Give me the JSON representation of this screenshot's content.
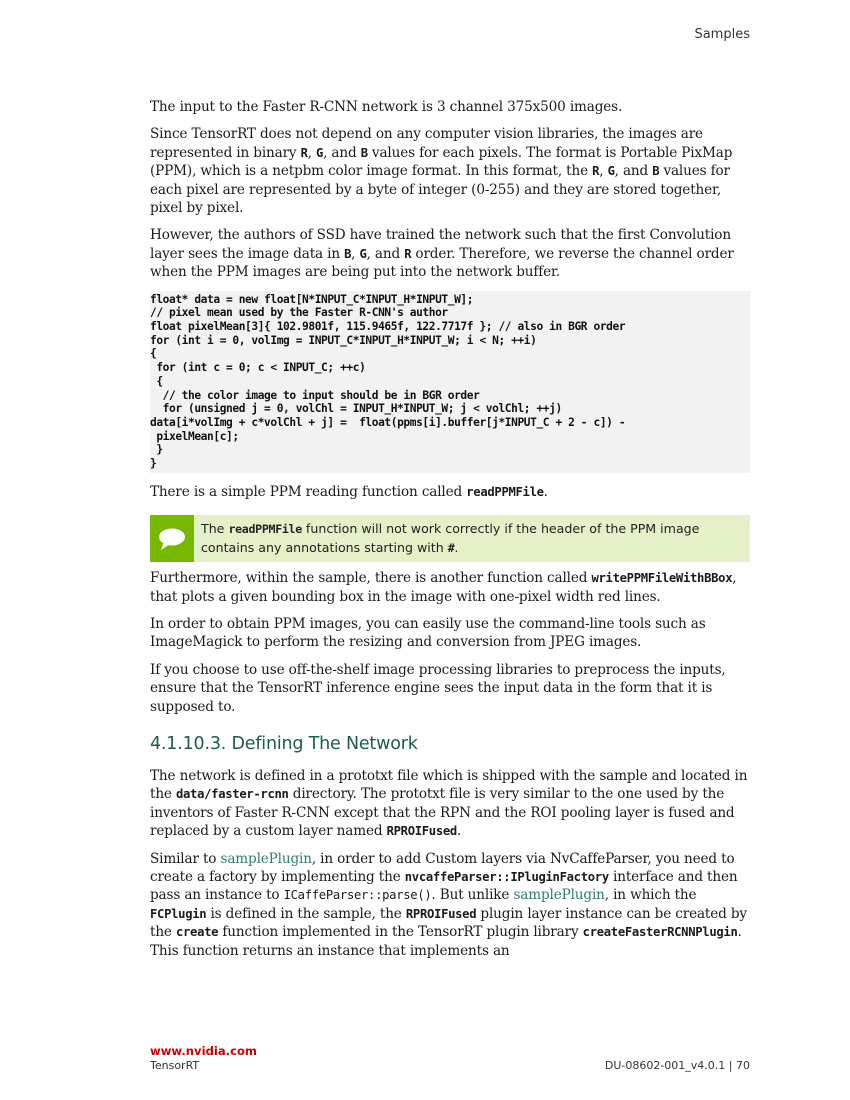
{
  "header": {
    "section": "Samples"
  },
  "body": {
    "p1": "The input to the Faster R-CNN network is 3 channel 375x500 images.",
    "p2": {
      "a": "Since TensorRT does not depend on any computer vision libraries, the images are represented in binary ",
      "r": "R",
      "b": ", ",
      "g": "G",
      "c": ", and ",
      "bl": "B",
      "d": " values for each pixels. The format is Portable PixMap (PPM), which is a netpbm color image format. In this format, the ",
      "r2": "R",
      "e": ", ",
      "g2": "G",
      "f": ", and ",
      "b2": "B",
      "g_text": " values for each pixel are represented by a byte of integer (0-255) and they are stored together, pixel by pixel."
    },
    "p3": {
      "a": "However, the authors of SSD have trained the network such that the first Convolution layer sees the image data in ",
      "b": "B",
      "c": ", ",
      "g": "G",
      "d": ", and ",
      "r": "R",
      "e": " order. Therefore, we reverse the channel order when the PPM images are being put into the network buffer."
    },
    "code": "float* data = new float[N*INPUT_C*INPUT_H*INPUT_W];\n// pixel mean used by the Faster R-CNN's author\nfloat pixelMean[3]{ 102.9801f, 115.9465f, 122.7717f }; // also in BGR order\nfor (int i = 0, volImg = INPUT_C*INPUT_H*INPUT_W; i < N; ++i)\n{\n for (int c = 0; c < INPUT_C; ++c)\n {\n  // the color image to input should be in BGR order\n  for (unsigned j = 0, volChl = INPUT_H*INPUT_W; j < volChl; ++j)\ndata[i*volImg + c*volChl + j] =  float(ppms[i].buffer[j*INPUT_C + 2 - c]) -\n pixelMean[c];\n }\n}",
    "p4": {
      "a": "There is a simple PPM reading function called ",
      "code": "readPPMFile",
      "b": "."
    },
    "note": {
      "a": "The ",
      "code": "readPPMFile",
      "b": " function will not work correctly if the header of the PPM image contains any annotations starting with ",
      "hash": "#",
      "c": "."
    },
    "p5": {
      "a": "Furthermore, within the sample, there is another function called ",
      "code": "writePPMFileWithBBox",
      "b": ", that plots a given bounding box in the image with one-pixel width red lines."
    },
    "p6": "In order to obtain PPM images, you can easily use the command-line tools such as ImageMagick to perform the resizing and conversion from JPEG images.",
    "p7": "If you choose to use off-the-shelf image processing libraries to preprocess the inputs, ensure that the TensorRT inference engine sees the input data in the form that it is supposed to.",
    "heading": "4.1.10.3. Defining The Network",
    "p8": {
      "a": "The network is defined in a prototxt file which is shipped with the sample and located in the ",
      "code": "data/faster-rcnn",
      "b": " directory. The prototxt file is very similar to the one used by the inventors of Faster R-CNN except that the RPN and the ROI pooling layer is fused and replaced by a custom layer named ",
      "code2": "RPROIFused",
      "c": "."
    },
    "p9": {
      "a": "Similar to ",
      "link1": "samplePlugin",
      "b": ", in order to add Custom layers via NvCaffeParser, you need to create a factory by implementing the ",
      "code1": "nvcaffeParser::IPluginFactory",
      "c": " interface and then pass an instance to ",
      "code2": "ICaffeParser::parse()",
      "d": ". But unlike ",
      "link2": "samplePlugin",
      "e": ", in which the ",
      "code3": "FCPlugin",
      "f": " is defined in the sample, the ",
      "code4": "RPROIFused",
      "g": " plugin layer instance can be created by the ",
      "code5": "create",
      "h": " function implemented in the TensorRT plugin library ",
      "code6": "createFasterRCNNPlugin",
      "i": ". This function returns an instance that implements an"
    }
  },
  "footer": {
    "brand": "www.nvidia.com",
    "product": "TensorRT",
    "doc_id": "DU-08602-001_v4.0.1 | 70"
  },
  "colors": {
    "accent_green": "#76b900",
    "note_bg": "#e4f0c8",
    "heading": "#1e5a4e",
    "brand_red": "#cc0000"
  }
}
